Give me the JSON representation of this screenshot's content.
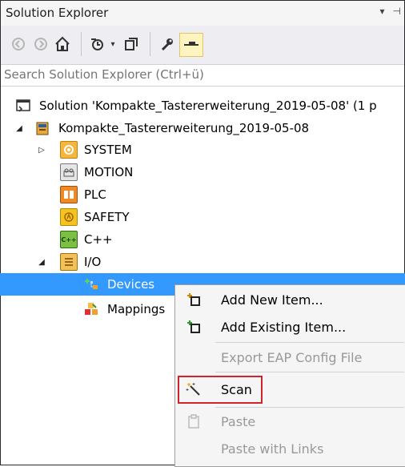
{
  "panel": {
    "title": "Solution Explorer",
    "controls": [
      "▾",
      "⊣"
    ]
  },
  "toolbar": {
    "items": [
      "back-icon",
      "forward-icon",
      "home-icon",
      "history-icon",
      "dropdown-icon",
      "switch-views-icon",
      "properties-icon",
      "pin-icon"
    ]
  },
  "search": {
    "placeholder": "Search Solution Explorer (Ctrl+ü)"
  },
  "tree": {
    "solution": "Solution 'Kompakte_Tastererweiterung_2019-05-08' (1 p",
    "project": "Kompakte_Tastererweiterung_2019-05-08",
    "nodes": {
      "system": "SYSTEM",
      "motion": "MOTION",
      "plc": "PLC",
      "safety": "SAFETY",
      "cpp": "C++",
      "io": "I/O",
      "devices": "Devices",
      "mappings": "Mappings"
    }
  },
  "context_menu": {
    "add_new": "Add New Item...",
    "add_existing": "Add Existing Item...",
    "export_eap": "Export EAP Config File",
    "scan": "Scan",
    "paste": "Paste",
    "paste_links": "Paste with Links"
  },
  "colors": {
    "selection": "#3399ff",
    "highlight_box": "#d0232b"
  }
}
